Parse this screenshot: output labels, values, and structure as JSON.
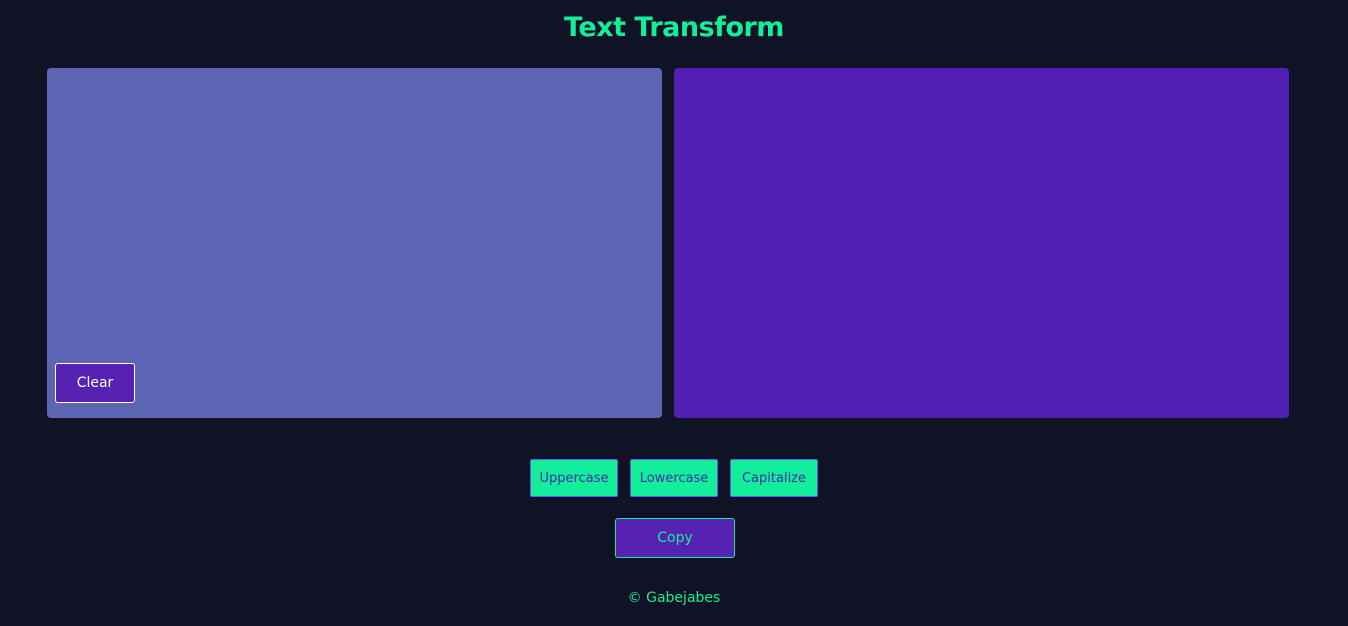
{
  "header": {
    "title": "Text Transform"
  },
  "input_panel": {
    "value": "",
    "clear_label": "Clear"
  },
  "output_panel": {
    "value": ""
  },
  "transforms": {
    "uppercase_label": "Uppercase",
    "lowercase_label": "Lowercase",
    "capitalize_label": "Capitalize"
  },
  "actions": {
    "copy_label": "Copy"
  },
  "footer": {
    "text": "© Gabejabes"
  },
  "colors": {
    "background": "#101225",
    "accent_green": "#12ee9a",
    "input_panel": "#5c64b4",
    "output_panel": "#521fb4",
    "button_purple": "#5721b3",
    "button_text_dark": "#4a2bb0"
  }
}
